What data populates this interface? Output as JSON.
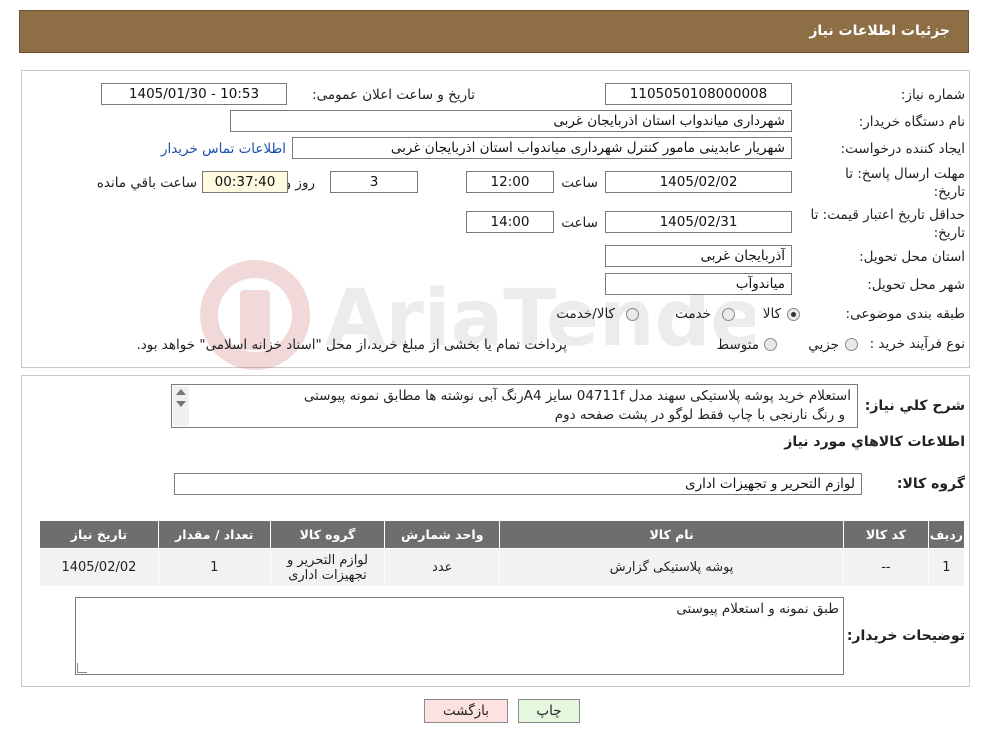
{
  "header": {
    "title": "جزئیات اطلاعات نیاز"
  },
  "form": {
    "need_number": {
      "label": "شماره نیاز:",
      "value": "1105050108000008"
    },
    "announce": {
      "label": "تاریخ و ساعت اعلان عمومی:",
      "value": "1405/01/30 - 10:53"
    },
    "buyer_org": {
      "label": "نام دستگاه خریدار:",
      "value": "شهرداری میاندواب استان اذربایجان غربی"
    },
    "requester": {
      "label": "ایجاد کننده درخواست:",
      "value": "شهریار  عابدینی مامور کنترل شهرداری میاندواب استان اذربایجان غربی",
      "contact_link": "اطلاعات تماس خریدار"
    },
    "deadline": {
      "label_line1": "مهلت ارسال پاسخ: تا",
      "label_line2": "تاریخ:",
      "date": "1405/02/02",
      "time_label": "ساعت",
      "time": "12:00",
      "days": "3",
      "days_label": "روز و",
      "remaining": "00:37:40",
      "remaining_label": "ساعت باقي مانده"
    },
    "validity": {
      "label_line1": "حداقل تاریخ اعتبار قیمت: تا",
      "label_line2": "تاریخ:",
      "date": "1405/02/31",
      "time_label": "ساعت",
      "time": "14:00"
    },
    "province": {
      "label": "استان محل تحویل:",
      "value": "آذربایجان غربی"
    },
    "city": {
      "label": "شهر محل تحویل:",
      "value": "میاندوآب"
    },
    "category": {
      "label": "طبقه بندی موضوعی:",
      "options": [
        "کالا",
        "خدمت",
        "کالا/خدمت"
      ],
      "selected": "کالا"
    },
    "process": {
      "label": "نوع فرآیند خرید :",
      "options": [
        "جزیي",
        "متوسط"
      ],
      "note": "پرداخت تمام یا بخشی از مبلغ خرید،از محل \"اسناد خزانه اسلامی\" خواهد بود."
    }
  },
  "description": {
    "label": "شرح کلي نیاز:",
    "line1": "استعلام خرید پوشه پلاستیکی سهند مدل 04711f سایز A4رنگ آبی نوشته ها مطابق نمونه پیوستی",
    "line2": "و رنگ نارنجی با چاپ فقط لوگو در پشت صفحه دوم"
  },
  "goods": {
    "section_title": "اطلاعات کالاهاي مورد نیاز",
    "group_label": "گروه کالا:",
    "group_value": "لوازم التحریر و تجهیزات اداری",
    "table": {
      "headers": [
        "ردیف",
        "کد کالا",
        "نام کالا",
        "واحد شمارش",
        "گروه کالا",
        "تعداد / مقدار",
        "تاریخ نیاز"
      ],
      "rows": [
        {
          "row": "1",
          "code": "--",
          "name": "پوشه پلاستیکی گزارش",
          "unit": "عدد",
          "group_line1": "لوازم التحریر و",
          "group_line2": "تجهیزات اداری",
          "qty": "1",
          "date": "1405/02/02"
        }
      ]
    }
  },
  "buyer_notes": {
    "label": "توضیحات خریدار:",
    "value": "طبق نمونه و استعلام پیوستی"
  },
  "buttons": {
    "print": "چاپ",
    "back": "بازگشت"
  },
  "watermark": {
    "text": "AriaTender.neT"
  },
  "colors": {
    "header": "#8d6e45",
    "table_header": "#6e6e6e",
    "back_button": "#fde2e2",
    "print_button": "#e6f7df",
    "timer": "#fffbe0"
  }
}
